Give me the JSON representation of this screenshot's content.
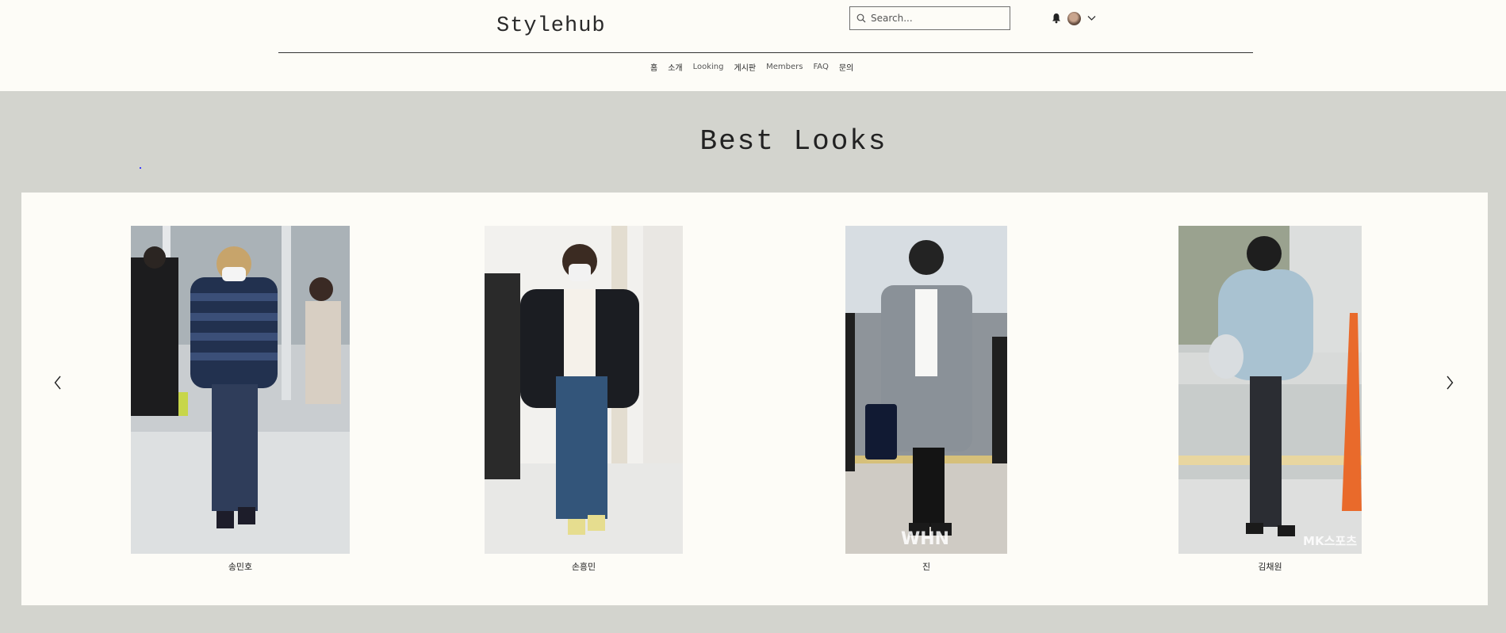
{
  "header": {
    "logo": "Stylehub",
    "search_placeholder": "Search...",
    "nav": [
      {
        "label": "홈"
      },
      {
        "label": "소개"
      },
      {
        "label": "Looking"
      },
      {
        "label": "게시판"
      },
      {
        "label": "Members"
      },
      {
        "label": "FAQ"
      },
      {
        "label": "문의"
      }
    ]
  },
  "section": {
    "title": "Best Looks"
  },
  "carousel": {
    "items": [
      {
        "name": "송민호",
        "image": "airport-look-striped-sweater"
      },
      {
        "name": "손흥민",
        "image": "airport-look-black-jacket-jeans"
      },
      {
        "name": "진",
        "image": "airport-look-grey-coat"
      },
      {
        "name": "김채원",
        "image": "airport-look-blue-fur-jacket"
      }
    ],
    "watermarks": {
      "card3": "WHN",
      "card4": "MK스포츠"
    }
  },
  "colors": {
    "header_bg": "#fdfcf7",
    "page_bg": "#d3d4ce",
    "card_bg": "#fdfcf7"
  },
  "icons": [
    "search-icon",
    "bell-icon",
    "avatar",
    "chevron-down-icon",
    "chevron-left-icon",
    "chevron-right-icon"
  ]
}
